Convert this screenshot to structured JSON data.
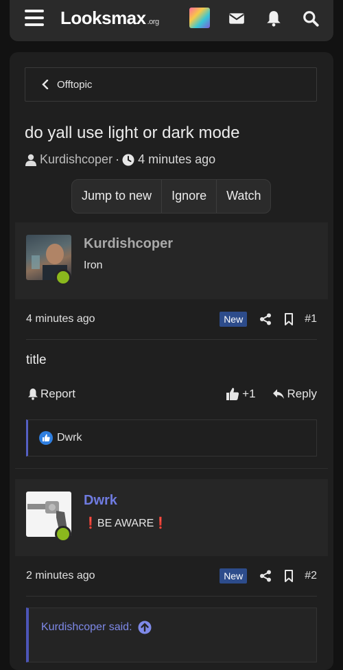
{
  "header": {
    "logo_main": "Looksmax",
    "logo_suffix": ".org",
    "icons": [
      "menu-icon",
      "envelope-icon",
      "bell-icon",
      "search-icon"
    ]
  },
  "breadcrumb": {
    "label": "Offtopic"
  },
  "thread": {
    "title": "do yall use light or dark mode",
    "author": "Kurdishcoper",
    "separator": "·",
    "time": "4 minutes ago"
  },
  "thread_actions": [
    "Jump to new",
    "Ignore",
    "Watch"
  ],
  "posts": [
    {
      "username": "Kurdishcoper",
      "user_title": "Iron",
      "time": "4 minutes ago",
      "badge": "New",
      "number": "#1",
      "body": "title",
      "report_label": "Report",
      "like_count": "+1",
      "reply_label": "Reply",
      "reaction_user": "Dwrk"
    },
    {
      "username": "Dwrk",
      "user_title_mark_left": "❗",
      "user_title": "BE AWARE",
      "user_title_mark_right": "❗",
      "time": "2 minutes ago",
      "badge": "New",
      "number": "#2",
      "quote_author": "Kurdishcoper said:"
    }
  ],
  "colors": {
    "background": "#121212",
    "card": "#1f1f1f",
    "user_block": "#262626",
    "badge_new": "#2d4c8b",
    "online": "#8ab81d",
    "username_post1": "#a9a9a9",
    "username_post2": "#6f7be0",
    "reaction_border": "#5560c4"
  }
}
